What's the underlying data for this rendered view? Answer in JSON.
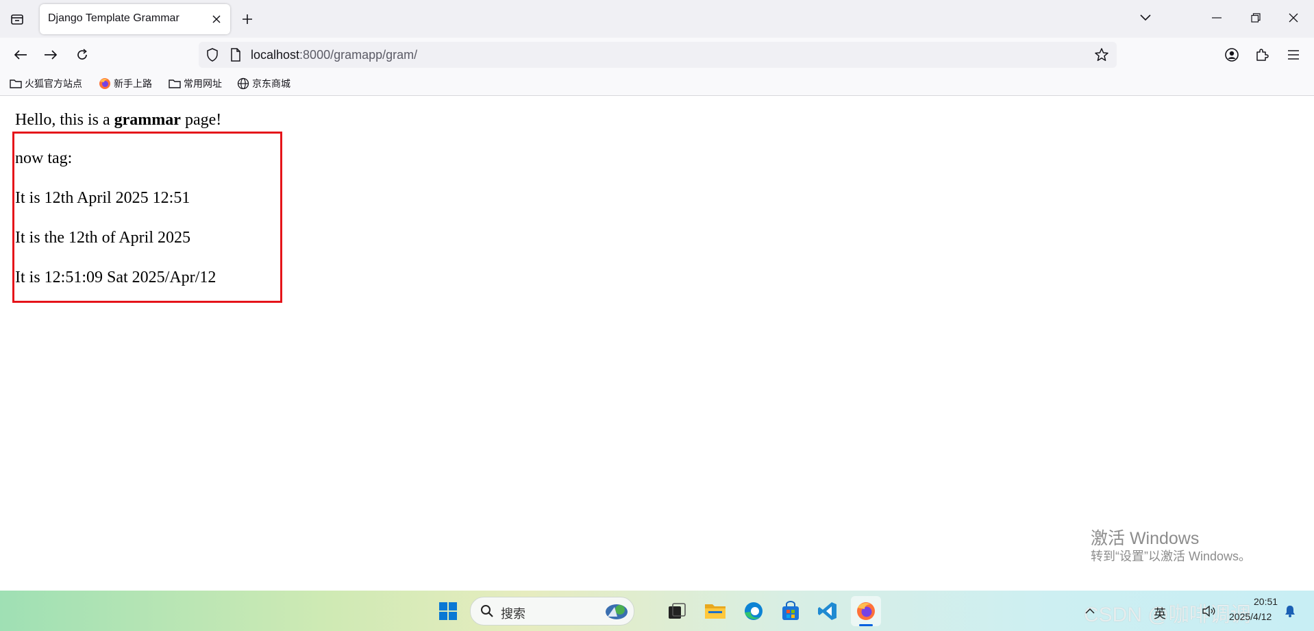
{
  "browser": {
    "tab_title": "Django Template Grammar",
    "url_host": "localhost",
    "url_rest": ":8000/gramapp/gram/",
    "bookmarks": [
      {
        "label": "火狐官方站点",
        "icon": "folder-icon"
      },
      {
        "label": "新手上路",
        "icon": "firefox-icon"
      },
      {
        "label": "常用网址",
        "icon": "folder-icon"
      },
      {
        "label": "京东商城",
        "icon": "globe-icon"
      }
    ]
  },
  "page": {
    "heading_prefix": "Hello, this is a ",
    "heading_bold": "grammar",
    "heading_suffix": " page!",
    "now_tag_label": "now tag:",
    "lines": [
      "It is 12th April 2025 12:51",
      "It is the 12th of April 2025",
      "It is 12:51:09 Sat 2025/Apr/12"
    ],
    "highlight_color": "#e5141a"
  },
  "watermark": {
    "title": "激活 Windows",
    "subtitle": "转到“设置”以激活 Windows。"
  },
  "taskbar": {
    "search_label": "搜索",
    "ime_label": "英",
    "time": "20:51",
    "date": "2025/4/12",
    "overlay_watermark": "CSDN @咖啡调调"
  },
  "colors": {
    "accent": "#0060df",
    "tabstrip_bg": "#f0f0f4",
    "toolbar_bg": "#f9f9fb"
  }
}
